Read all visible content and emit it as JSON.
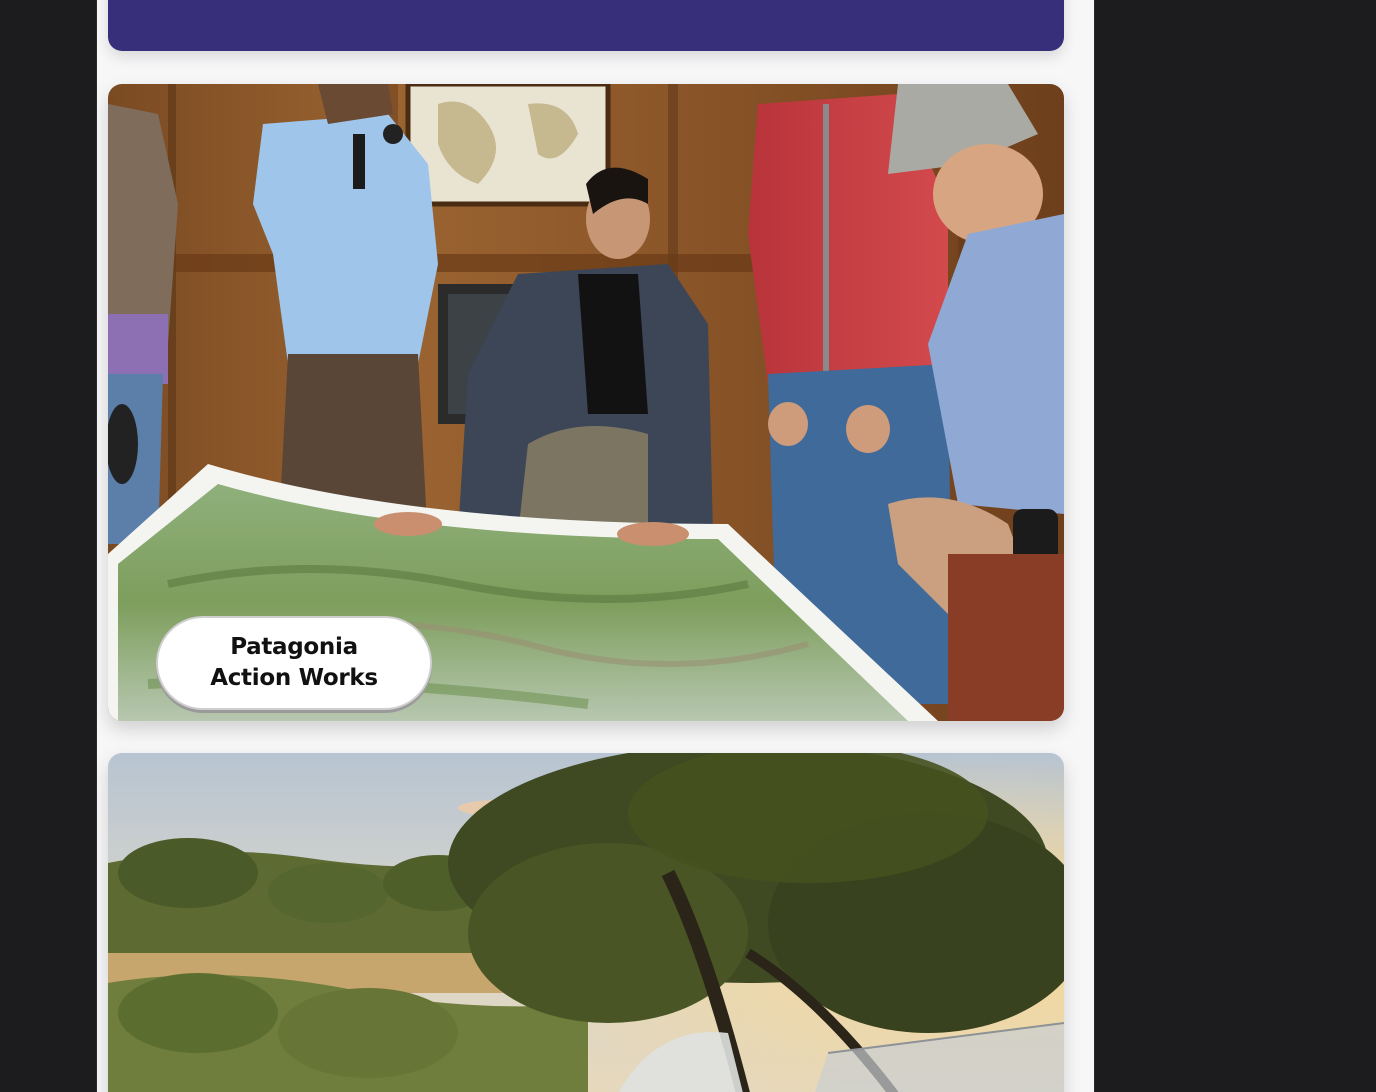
{
  "cards": [
    {
      "label": "Patagonia Action Works"
    }
  ],
  "colors": {
    "page_background": "#1c1c1e",
    "column_background": "#f7f7f8",
    "promo_card": "#372f7a",
    "label_background": "#ffffff",
    "label_text": "#111111"
  },
  "images": {
    "card_one": "group-of-people-looking-at-large-map-image",
    "card_two": "oak-trees-at-sunset-image"
  }
}
